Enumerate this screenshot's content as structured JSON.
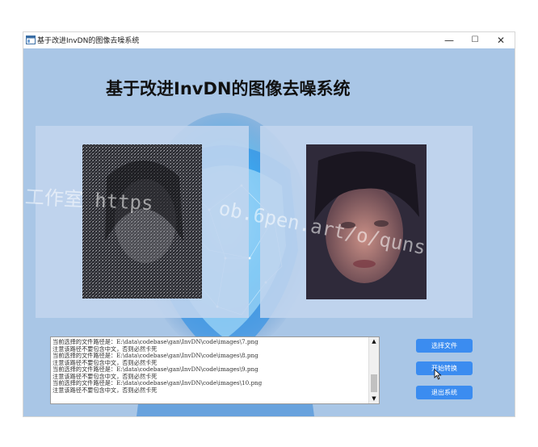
{
  "window": {
    "title": "基于改进InvDN的图像去噪系统",
    "controls": {
      "minimize": "—",
      "maximize": "☐",
      "close": "✕"
    }
  },
  "main_title": "基于改进InvDN的图像去噪系统",
  "watermarks": [
    "工作室 https",
    "ob.6pen.art/o/quns"
  ],
  "log": {
    "lines": [
      "当前选择的文件路径是：E:\\data\\codebase\\gan\\InvDN\\code\\images\\7.png",
      "注意该路径不要包含中文，否则必然卡死",
      "当前选择的文件路径是：E:\\data\\codebase\\gan\\InvDN\\code\\images\\8.png",
      "注意该路径不要包含中文，否则必然卡死",
      "当前选择的文件路径是：E:\\data\\codebase\\gan\\InvDN\\code\\images\\9.png",
      "注意该路径不要包含中文，否则必然卡死",
      "当前选择的文件路径是：E:\\data\\codebase\\gan\\InvDN\\code\\images\\10.png",
      "注意该路径不要包含中文，否则必然卡死"
    ]
  },
  "buttons": {
    "select_file": "选择文件",
    "start_convert": "开始转换",
    "exit_system": "退出系统"
  },
  "colors": {
    "client_bg": "#a9c6e6",
    "button": "#3b8cf0",
    "panel": "#c1d5ee"
  }
}
